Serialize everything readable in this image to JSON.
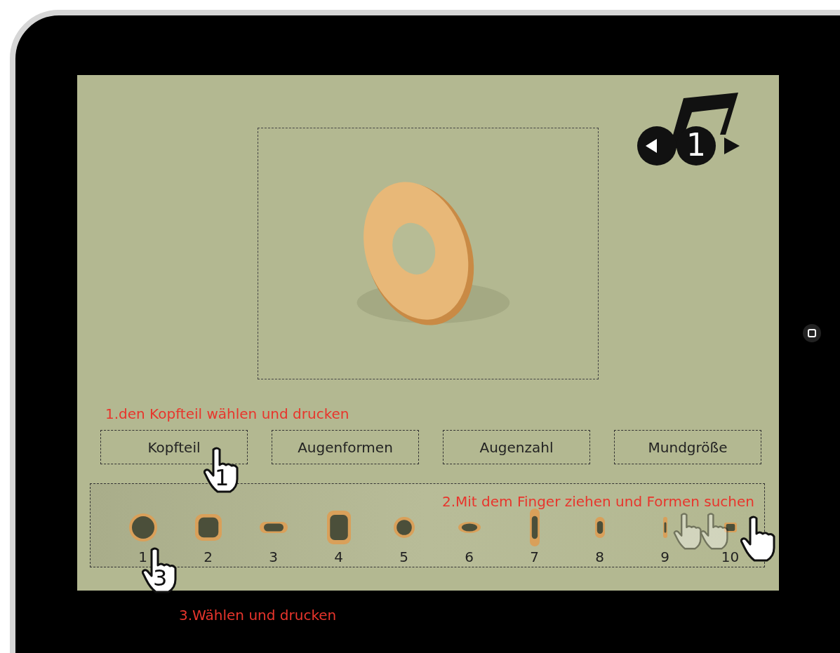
{
  "track": {
    "number": "1"
  },
  "preview": {
    "kind": "picture"
  },
  "steps": [
    "1.den Kopfteil wählen und drucken",
    "2.Mit dem Finger ziehen und Formen suchen",
    "3.Wählen und drucken"
  ],
  "categories": [
    "Kopfteil",
    "Augenformen",
    "Augenzahl",
    "Mundgröße"
  ],
  "shapes": [
    {
      "label": "1",
      "kind": "ring"
    },
    {
      "label": "2",
      "kind": "square"
    },
    {
      "label": "3",
      "kind": "slot"
    },
    {
      "label": "4",
      "kind": "tall"
    },
    {
      "label": "5",
      "kind": "circle"
    },
    {
      "label": "6",
      "kind": "oval"
    },
    {
      "label": "7",
      "kind": "long"
    },
    {
      "label": "8",
      "kind": "ellipse"
    },
    {
      "label": "9",
      "kind": "thin"
    },
    {
      "label": "10",
      "kind": "small"
    }
  ],
  "markers": [
    {
      "number": "1"
    },
    {
      "number": "3"
    }
  ]
}
